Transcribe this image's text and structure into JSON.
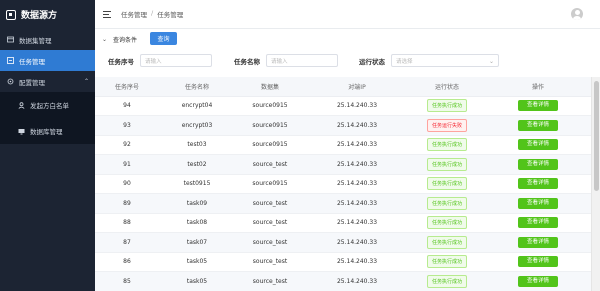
{
  "brand": {
    "title": "数据源方"
  },
  "sidebar": {
    "items": [
      {
        "label": "数据集管理",
        "icon": "dataset-icon",
        "active": false
      },
      {
        "label": "任务管理",
        "icon": "task-icon",
        "active": true
      },
      {
        "label": "配置管理",
        "icon": "config-icon",
        "active": false
      },
      {
        "label": "发起方白名单",
        "icon": "user-icon",
        "active": false
      },
      {
        "label": "数据库管理",
        "icon": "monitor-icon",
        "active": false
      }
    ]
  },
  "header": {
    "breadcrumb": [
      "任务管理",
      "/",
      "任务管理"
    ]
  },
  "query": {
    "title": "查询条件",
    "button": "查询",
    "fields": [
      {
        "label": "任务序号",
        "placeholder": "请输入"
      },
      {
        "label": "任务名称",
        "placeholder": "请输入"
      },
      {
        "label": "运行状态",
        "placeholder": "请选择"
      }
    ]
  },
  "table": {
    "columns": [
      "任务序号",
      "任务名称",
      "数据集",
      "对端IP",
      "运行状态",
      "操作"
    ],
    "action_label": "查看详情",
    "rows": [
      {
        "id": "94",
        "name": "encrypt04",
        "dataset": "source0915",
        "ip": "25.14.240.33",
        "status": "任务执行成功",
        "status_type": "success"
      },
      {
        "id": "93",
        "name": "encrypt03",
        "dataset": "source0915",
        "ip": "25.14.240.33",
        "status": "任务运行失败",
        "status_type": "fail"
      },
      {
        "id": "92",
        "name": "test03",
        "dataset": "source0915",
        "ip": "25.14.240.33",
        "status": "任务执行成功",
        "status_type": "success"
      },
      {
        "id": "91",
        "name": "test02",
        "dataset": "source_test",
        "ip": "25.14.240.33",
        "status": "任务执行成功",
        "status_type": "success"
      },
      {
        "id": "90",
        "name": "test0915",
        "dataset": "source0915",
        "ip": "25.14.240.33",
        "status": "任务执行成功",
        "status_type": "success"
      },
      {
        "id": "89",
        "name": "task09",
        "dataset": "source_test",
        "ip": "25.14.240.33",
        "status": "任务执行成功",
        "status_type": "success"
      },
      {
        "id": "88",
        "name": "task08",
        "dataset": "source_test",
        "ip": "25.14.240.33",
        "status": "任务执行成功",
        "status_type": "success"
      },
      {
        "id": "87",
        "name": "task07",
        "dataset": "source_test",
        "ip": "25.14.240.33",
        "status": "任务执行成功",
        "status_type": "success"
      },
      {
        "id": "86",
        "name": "task05",
        "dataset": "source_test",
        "ip": "25.14.240.33",
        "status": "任务执行成功",
        "status_type": "success"
      },
      {
        "id": "85",
        "name": "task05",
        "dataset": "source_test",
        "ip": "25.14.240.33",
        "status": "任务执行成功",
        "status_type": "success"
      }
    ]
  },
  "colors": {
    "sidebar_bg": "#1c2433",
    "active": "#2f7bd3",
    "success": "#52c41a",
    "fail": "#f5222d",
    "primary": "#3a86e0"
  }
}
